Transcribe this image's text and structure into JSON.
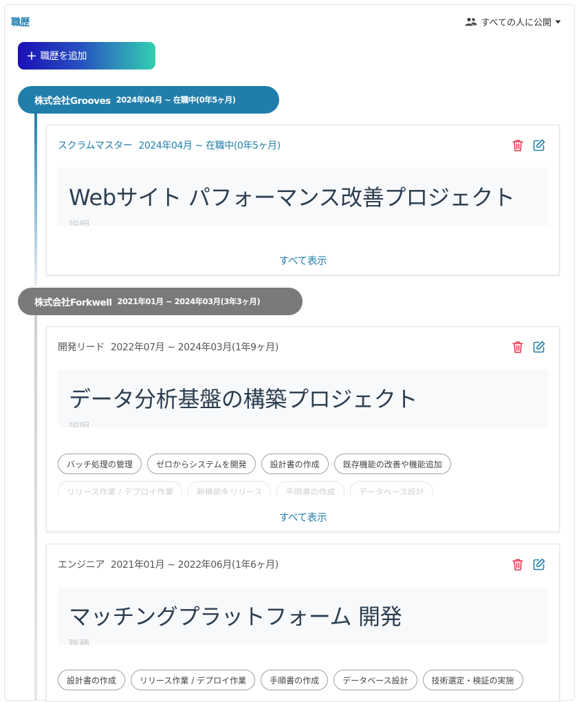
{
  "section": {
    "title": "職歴",
    "visibility_label": "すべての人に公開",
    "add_button_label": "職歴を追加",
    "show_all_label": "すべて表示"
  },
  "colors": {
    "accent": "#217eaa",
    "company_active": "#217eaa",
    "company_past": "#7a7a7a",
    "delete_icon": "#e0384f",
    "edit_icon": "#217eaa",
    "add_gradient_start": "#1a10b6",
    "add_gradient_end": "#33d0b1"
  },
  "companies": [
    {
      "name": "株式会社Grooves",
      "period": "2024年04月 ~ 在職中(0年5ヶ月)",
      "roles": [
        {
          "role": "スクラムマスター",
          "period": "2024年04月 ~ 在職中(0年5ヶ月)",
          "project_title": "Webサイト パフォーマンス改善プロジェクト",
          "field_label": "説明"
        }
      ]
    },
    {
      "name": "株式会社Forkwell",
      "period": "2021年01月 ~ 2024年03月(3年3ヶ月)",
      "roles": [
        {
          "role": "開発リード",
          "period": "2022年07月 ~ 2024年03月(1年9ヶ月)",
          "project_title": "データ分析基盤の構築プロジェクト",
          "field_label": "説明",
          "tags": [
            "バッチ処理の管理",
            "ゼロからシステムを開発",
            "設計書の作成",
            "既存機能の改善や機能追加"
          ],
          "tags_faded": [
            "リリース作業 / デプロイ作業",
            "新機能をリリース",
            "手順書の作成",
            "データベース設計"
          ]
        },
        {
          "role": "エンジニア",
          "period": "2021年01月 ~ 2022年06月(1年6ヶ月)",
          "project_title": "マッチングプラットフォーム 開発",
          "field_label": "職種",
          "tags": [
            "設計書の作成",
            "リリース作業 / デプロイ作業",
            "手順書の作成",
            "データベース設計",
            "技術選定・検証の実施"
          ]
        }
      ]
    }
  ]
}
